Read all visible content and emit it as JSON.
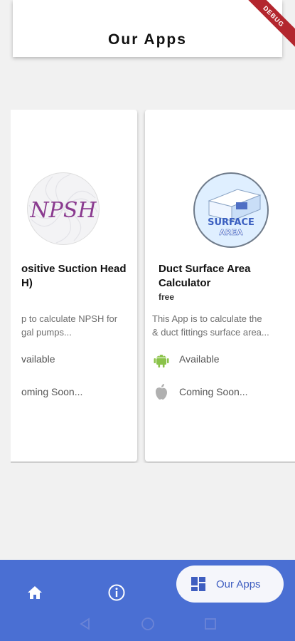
{
  "header": {
    "title": "Our Apps",
    "debug_label": "DEBUG"
  },
  "apps": [
    {
      "logo_text": "NPSH",
      "title_line1": "ositive Suction Head",
      "title_line2": "H)",
      "desc_line1": "p to calculate NPSH for",
      "desc_line2": "gal pumps...",
      "android_label": "vailable",
      "ios_label": "oming Soon..."
    },
    {
      "logo_text_1": "SURFACE",
      "logo_text_2": "AREA",
      "title_line1": "Duct Surface Area",
      "title_line2": "Calculator",
      "price": "free",
      "desc_line1": "This App is to calculate the",
      "desc_line2": "& duct fittings surface area...",
      "android_label": "Available",
      "ios_label": "Coming Soon..."
    }
  ],
  "bottom_nav": {
    "items": [
      {
        "icon": "home-icon"
      },
      {
        "icon": "info-icon"
      },
      {
        "icon": "apps-grid-icon",
        "label": "Our Apps",
        "active": true
      }
    ]
  },
  "colors": {
    "nav_bg": "#4a6fd3",
    "accent": "#3f5ec0",
    "android_green": "#8bc34a",
    "debug_banner": "#b3262e"
  }
}
